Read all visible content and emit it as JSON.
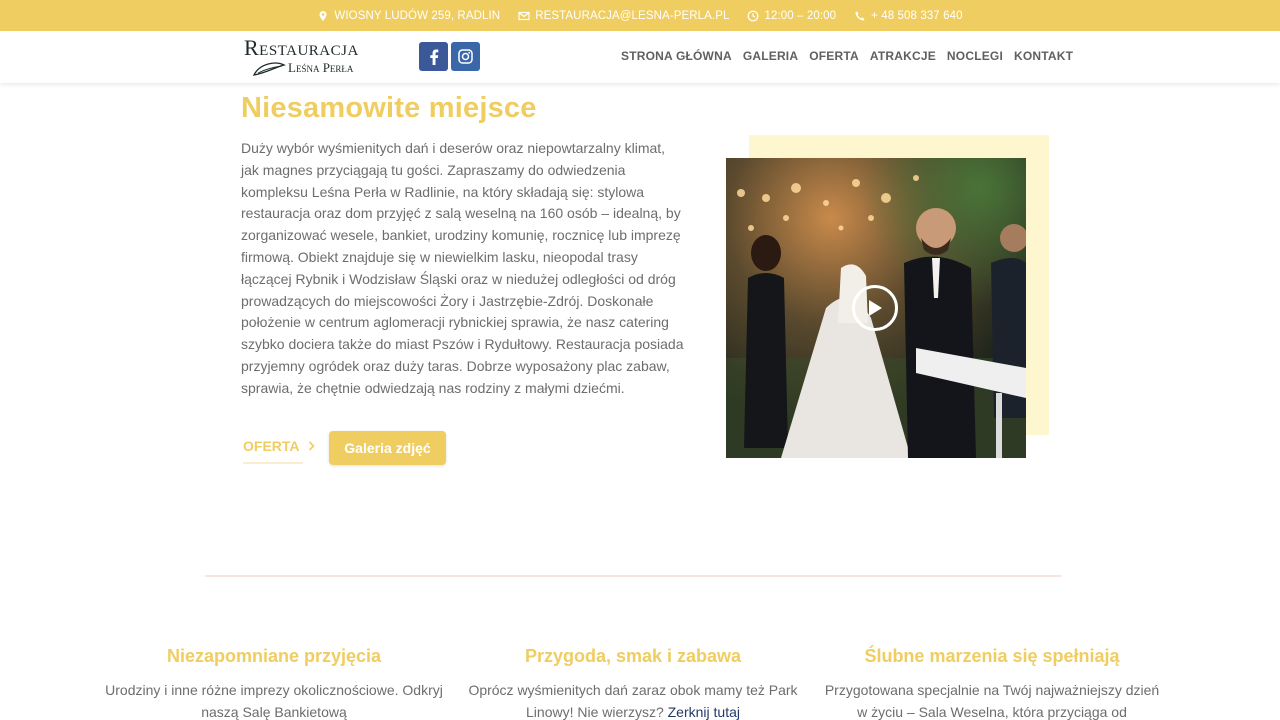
{
  "topbar": {
    "address": "WIOSNY LUDÓW 259, RADLIN",
    "email": "RESTAURACJA@LESNA-PERLA.PL",
    "hours": "12:00 – 20:00",
    "phone": "+ 48 508 337 640"
  },
  "logo": {
    "line1": "Restauracja",
    "line2": "Leśna Perła"
  },
  "nav": [
    "STRONA GŁÓWNA",
    "GALERIA",
    "OFERTA",
    "ATRAKCJE",
    "NOCLEGI",
    "KONTAKT"
  ],
  "hero": {
    "headline": "Niesamowite miejsce",
    "intro": "Duży wybór wyśmienitych dań i deserów oraz niepowtarzalny klimat, jak magnes przyciągają tu gości. Zapraszamy do odwiedzenia kompleksu Leśna Perła w Radlinie, na który składają się: stylowa restauracja oraz dom przyjęć z salą weselną na 160 osób – idealną, by zorganizować wesele, bankiet, urodziny komunię, rocznicę lub imprezę firmową. Obiekt znajduje się w niewielkim lasku, nieopodal trasy łączącej Rybnik i Wodzisław Śląski oraz w niedużej odległości od dróg prowadzących do miejscowości Żory i Jastrzębie-Zdrój. Doskonałe położenie w centrum aglomeracji rybnickiej sprawia, że nasz catering szybko dociera także do miast Pszów i Rydułtowy. Restauracja posiada przyjemny ogródek oraz duży taras. Dobrze wyposażony plac zabaw, sprawia, że chętnie odwiedzają nas rodziny z małymi dziećmi.",
    "btn_oferta": "OFERTA",
    "btn_galeria": "Galeria zdjęć"
  },
  "features": [
    {
      "title": "Niezapomniane przyjęcia",
      "text": "Urodziny i inne różne imprezy okolicznościowe. Odkryj naszą Salę Bankietową"
    },
    {
      "title": "Przygoda, smak i zabawa",
      "text": "Oprócz wyśmienitych dań zaraz obok mamy też Park Linowy! Nie wierzysz?",
      "link": "Zerknij tutaj"
    },
    {
      "title": "Ślubne marzenia się spełniają",
      "text": "Przygotowana specjalnie na Twój najważniejszy dzień w życiu – Sala Weselna, która przyciąga od"
    }
  ],
  "colors": {
    "accent": "#f0cd60",
    "facebook": "#3b5998",
    "instagram": "#3a67a8"
  }
}
